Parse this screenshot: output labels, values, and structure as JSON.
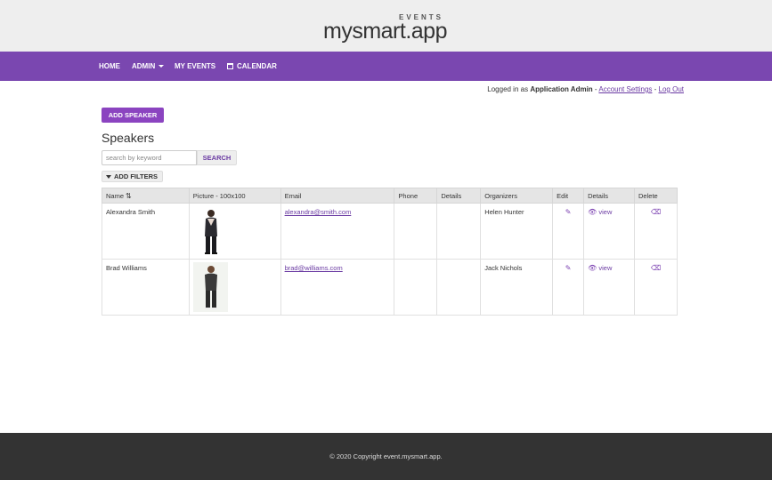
{
  "brand": {
    "tagline": "EVENTS",
    "name": "mysmart.app",
    "colors": {
      "accent": "#7a47b0",
      "button": "#8b44c0",
      "link": "#6a3aa2",
      "footer": "#333333"
    }
  },
  "nav": {
    "home": "HOME",
    "admin": "ADMIN",
    "my_events": "MY EVENTS",
    "calendar": "CALENDAR"
  },
  "session": {
    "prefix": "Logged in as",
    "user": "Application Admin",
    "sep1": " - ",
    "account_settings": "Account Settings",
    "sep2": " - ",
    "logout": "Log Out"
  },
  "actions": {
    "add_speaker": "ADD SPEAKER",
    "search_button": "SEARCH",
    "search_placeholder": "search by keyword",
    "add_filters": "ADD FILTERS"
  },
  "page": {
    "title": "Speakers"
  },
  "table": {
    "headers": {
      "name": "Name",
      "picture": "Picture - 100x100",
      "email": "Email",
      "phone": "Phone",
      "details": "Details",
      "organizers": "Organizers",
      "edit": "Edit",
      "details2": "Details",
      "delete": "Delete"
    },
    "rows": [
      {
        "name": "Alexandra Smith",
        "email": "alexandra@smith.com",
        "phone": "",
        "details": "",
        "organizers": "Helen Hunter",
        "view": "view"
      },
      {
        "name": "Brad Williams",
        "email": "brad@williams.com",
        "phone": "",
        "details": "",
        "organizers": "Jack Nichols",
        "view": "view"
      }
    ]
  },
  "icons": {
    "edit": "pencil-icon",
    "view": "eye-icon",
    "delete": "eraser-icon",
    "sort": "sort-alpha-icon",
    "filter": "funnel-icon",
    "calendar": "calendar-icon"
  },
  "footer": {
    "copyright": "© 2020 Copyright event.mysmart.app."
  }
}
